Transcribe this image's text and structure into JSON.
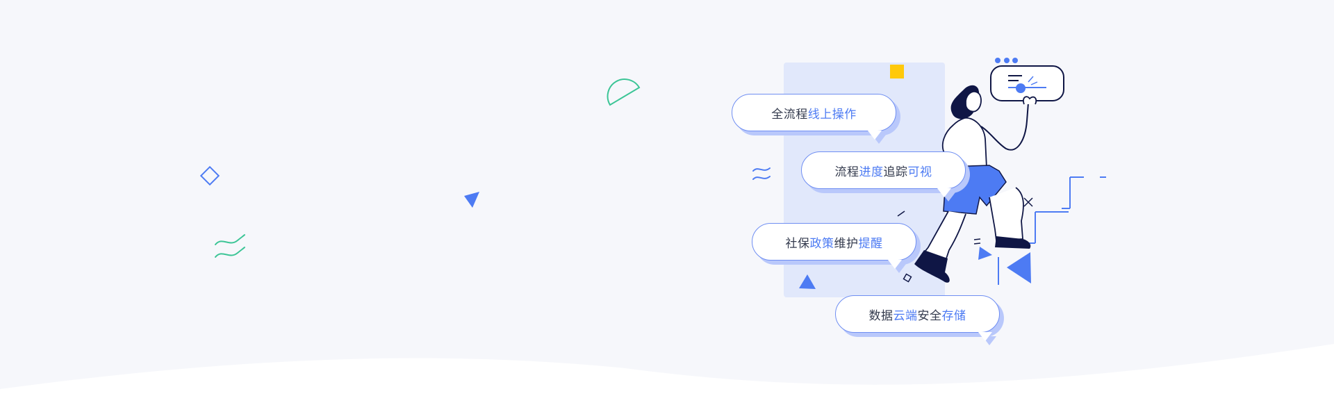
{
  "colors": {
    "background": "#f6f7fb",
    "accent_blue": "#4d7bf3",
    "light_panel": "#e1e8fb",
    "green": "#3cc596",
    "yellow": "#ffc90a",
    "navy": "#0f1645"
  },
  "features": [
    {
      "parts": [
        {
          "text": "全流程",
          "highlight": false
        },
        {
          "text": "线上操作",
          "highlight": true
        }
      ]
    },
    {
      "parts": [
        {
          "text": "流程",
          "highlight": false
        },
        {
          "text": "进度",
          "highlight": true
        },
        {
          "text": "追踪",
          "highlight": false
        },
        {
          "text": "可视",
          "highlight": true
        }
      ]
    },
    {
      "parts": [
        {
          "text": "社保",
          "highlight": false
        },
        {
          "text": "政策",
          "highlight": true
        },
        {
          "text": "维护",
          "highlight": false
        },
        {
          "text": "提醒",
          "highlight": true
        }
      ]
    },
    {
      "parts": [
        {
          "text": "数据",
          "highlight": false
        },
        {
          "text": "云端",
          "highlight": true
        },
        {
          "text": "安全",
          "highlight": false
        },
        {
          "text": "存储",
          "highlight": true
        }
      ]
    }
  ],
  "decorations": [
    "diamond-outline-icon",
    "triangle-icon",
    "wave-icon",
    "half-circle-icon",
    "square-icon"
  ]
}
